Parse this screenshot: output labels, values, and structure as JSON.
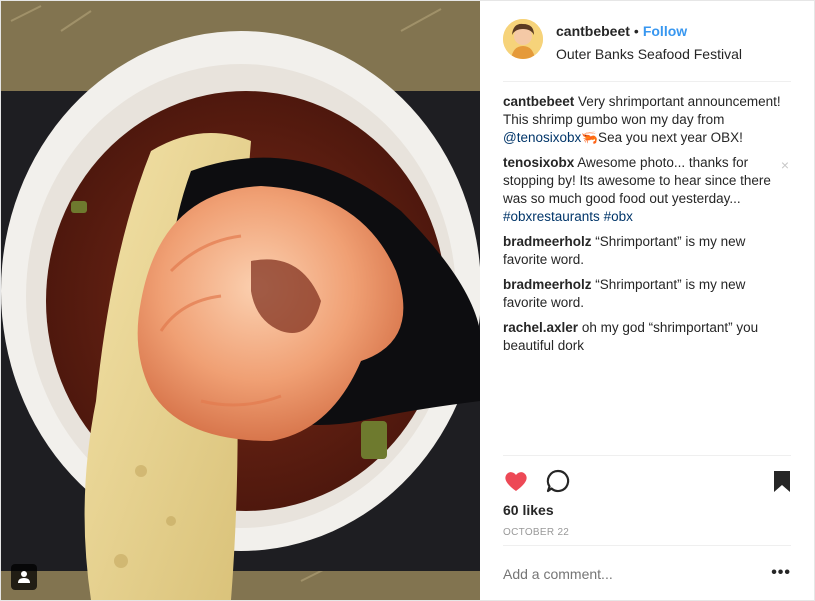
{
  "post": {
    "username": "cantbebeet",
    "separator": "•",
    "follow_label": "Follow",
    "location": "Outer Banks Seafood Festival"
  },
  "comments": [
    {
      "user": "cantbebeet",
      "parts": [
        {
          "text": "Very shrimportant announcement! This shrimp gumbo won my day from "
        },
        {
          "text": "@tenosixobx",
          "link": true
        },
        {
          "text": "🦐Sea you next year OBX!"
        }
      ]
    },
    {
      "user": "tenosixobx",
      "parts": [
        {
          "text": "Awesome photo... thanks for stopping by! Its awesome to hear since there was so much good food out yesterday... "
        },
        {
          "text": "#obxrestaurants",
          "link": true
        },
        {
          "text": " "
        },
        {
          "text": "#obx",
          "link": true
        }
      ],
      "close": "×"
    },
    {
      "user": "bradmeerholz",
      "parts": [
        {
          "text": "“Shrimportant” is my new favorite word."
        }
      ]
    },
    {
      "user": "bradmeerholz",
      "parts": [
        {
          "text": "“Shrimportant” is my new favorite word."
        }
      ]
    },
    {
      "user": "rachel.axler",
      "parts": [
        {
          "text": "oh my god “shrimportant” you beautiful dork"
        }
      ]
    }
  ],
  "actions": {
    "likes": "60 likes",
    "date": "OCTOBER 22",
    "icons": [
      "heart-icon",
      "comment-icon",
      "bookmark-icon",
      "user-tag-icon"
    ]
  },
  "add_comment": {
    "placeholder": "Add a comment...",
    "more": "•••"
  },
  "colors": {
    "heart": "#ed4956",
    "link": "#003569",
    "follow": "#3897f0",
    "muted": "#999999"
  }
}
